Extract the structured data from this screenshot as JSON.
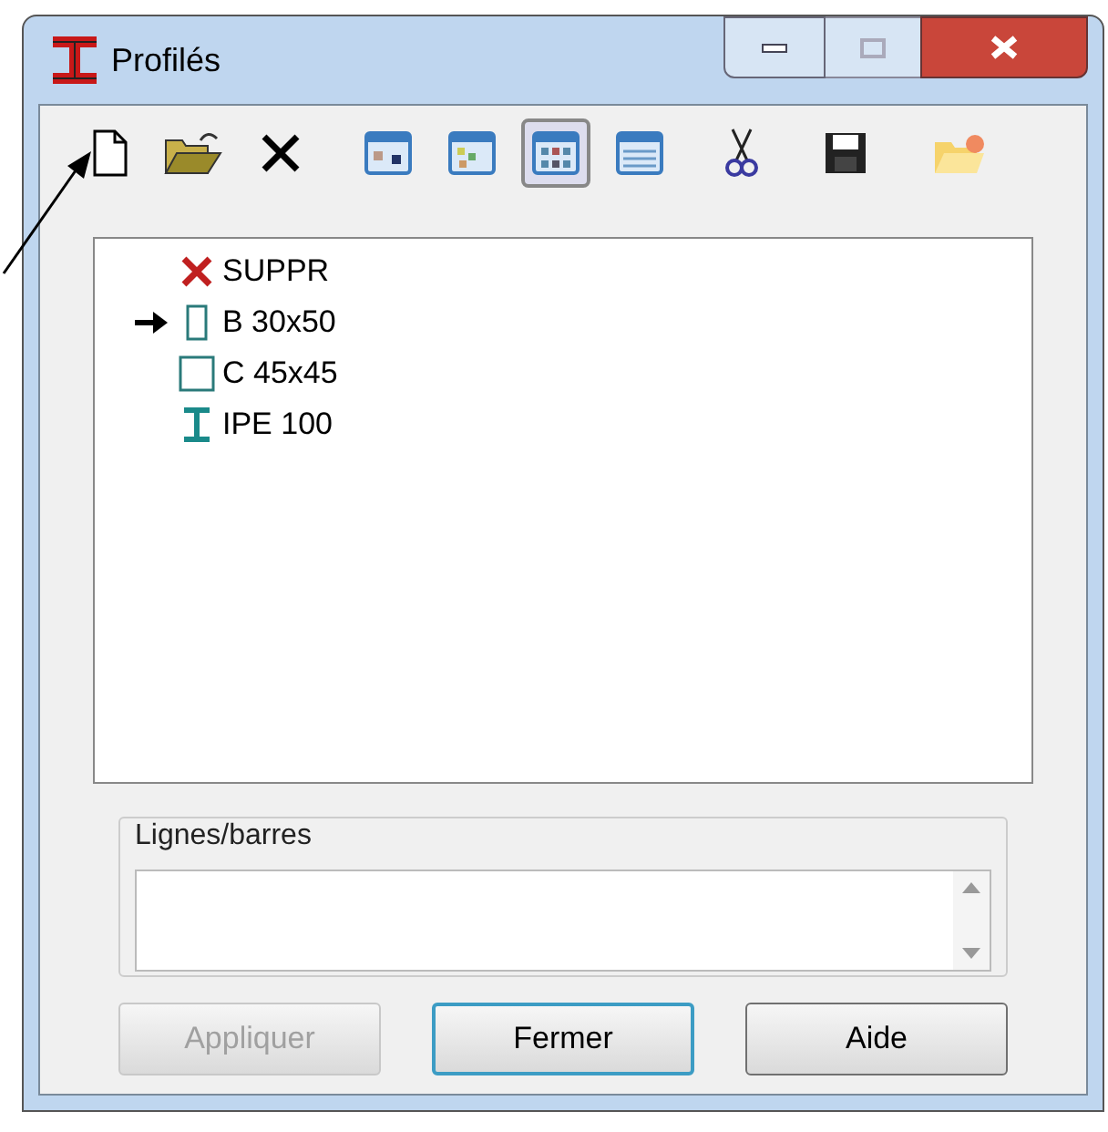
{
  "window": {
    "title": "Profilés"
  },
  "toolbar": [
    {
      "kind": "new",
      "selected": false
    },
    {
      "kind": "open",
      "selected": false
    },
    {
      "kind": "delete",
      "selected": false
    },
    {
      "kind": "view1",
      "selected": false
    },
    {
      "kind": "view2",
      "selected": false
    },
    {
      "kind": "view3",
      "selected": true
    },
    {
      "kind": "view4",
      "selected": false
    },
    {
      "kind": "cut",
      "selected": false
    },
    {
      "kind": "save",
      "selected": false
    },
    {
      "kind": "folder",
      "selected": false
    }
  ],
  "profiles": [
    {
      "kind": "delete",
      "label": "SUPPR",
      "selected": false
    },
    {
      "kind": "rect",
      "label": "B 30x50",
      "selected": true
    },
    {
      "kind": "square",
      "label": "C 45x45",
      "selected": false
    },
    {
      "kind": "ibeam",
      "label": "IPE 100",
      "selected": false
    }
  ],
  "group": {
    "title": "Lignes/barres"
  },
  "buttons": [
    {
      "label": "Appliquer",
      "disabled": true,
      "default": false
    },
    {
      "label": "Fermer",
      "disabled": false,
      "default": true
    },
    {
      "label": "Aide",
      "disabled": false,
      "default": false
    }
  ]
}
